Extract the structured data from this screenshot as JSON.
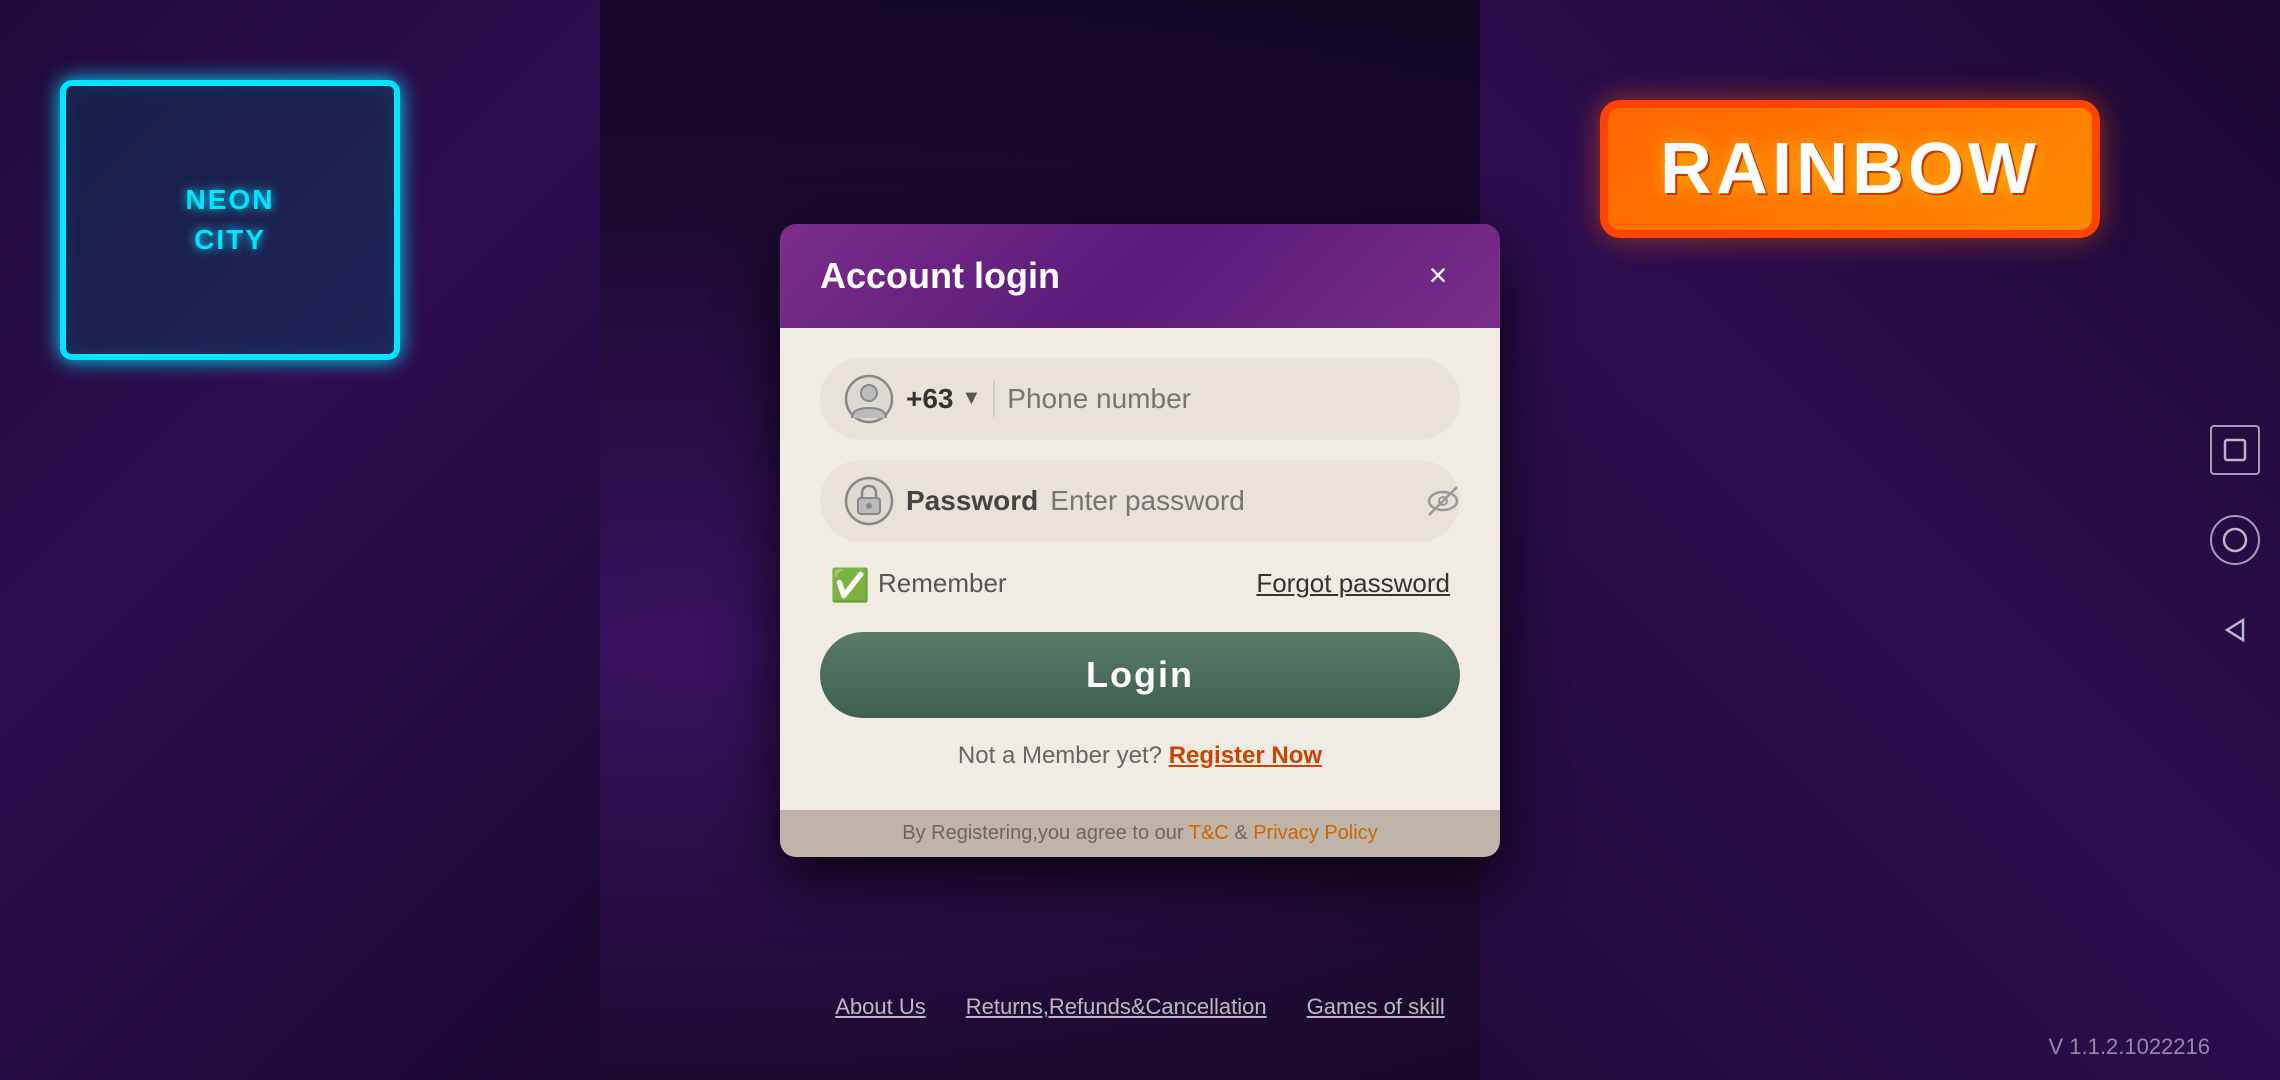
{
  "background": {
    "color_left": "#2d0a50",
    "color_right": "#1a0830"
  },
  "modal": {
    "title": "Account login",
    "close_label": "×",
    "phone_field": {
      "country_code": "+63",
      "placeholder": "Phone number",
      "dropdown_icon": "▼"
    },
    "password_field": {
      "label": "Password",
      "placeholder": "Enter password"
    },
    "remember": {
      "label": "Remember",
      "checked": true,
      "icon": "✅"
    },
    "forgot_password": {
      "label": "Forgot password"
    },
    "login_button": {
      "label": "Login"
    },
    "register": {
      "prefix_text": "Not a Member yet?",
      "link_text": "Register Now"
    },
    "tos_text": "By Registering,you agree to our T&C & Privacy Policy"
  },
  "footer": {
    "tos_text": "By Registering,you agree to our",
    "tos_link1": "T&C",
    "tos_amp": "&",
    "tos_link2": "Privacy Policy",
    "nav_items": [
      {
        "label": "About Us"
      },
      {
        "label": "Returns,Refunds&Cancellation"
      },
      {
        "label": "Games of skill"
      }
    ]
  },
  "android_nav": {
    "square_label": "□",
    "circle_label": "○",
    "triangle_label": "◁"
  },
  "version": {
    "text": "V 1.1.2.1022216"
  },
  "rainbow_sign": {
    "title": "RAINBOW"
  }
}
